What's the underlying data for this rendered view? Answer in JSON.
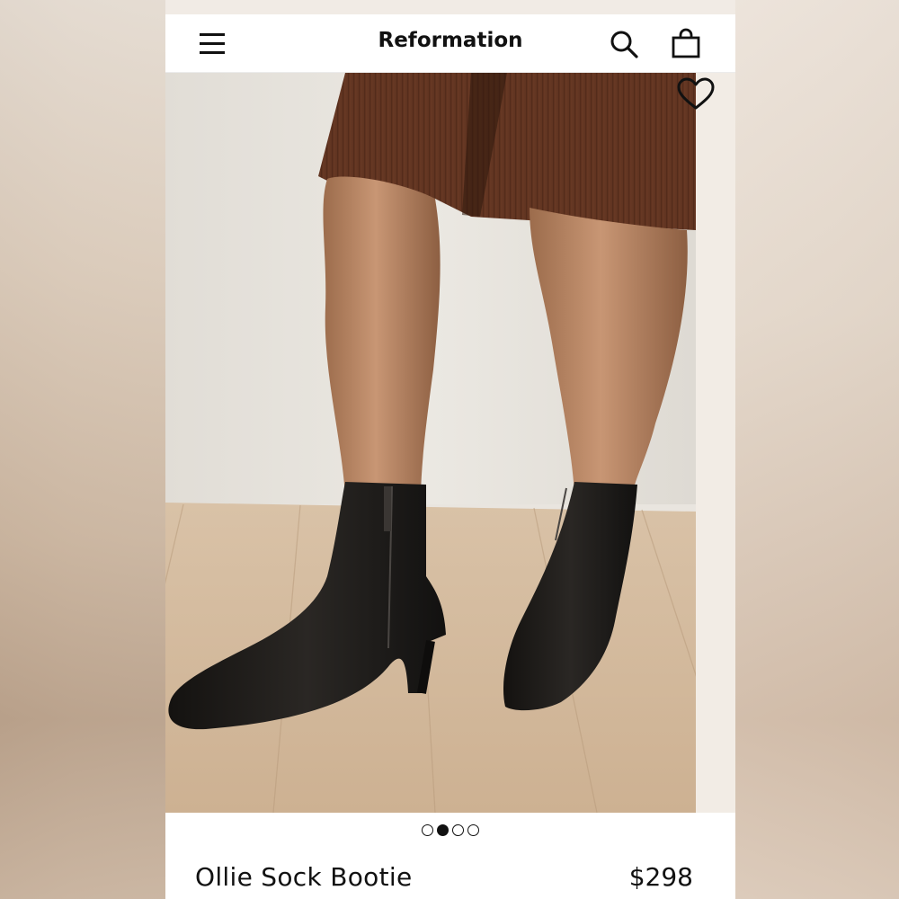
{
  "header": {
    "brand": "Reformation",
    "menu_icon": "hamburger-menu-icon",
    "search_icon": "search-icon",
    "bag_icon": "shopping-bag-icon"
  },
  "gallery": {
    "image_count": 4,
    "active_index": 1,
    "favorite_icon": "heart-outline-icon"
  },
  "product": {
    "name": "Ollie Sock Bootie",
    "price": "$298"
  },
  "colors": {
    "text": "#111111",
    "background": "#ffffff",
    "skirt": "#6a3a24",
    "boot": "#1b1917",
    "floor": "#d2b89c",
    "wall": "#e7e4de"
  }
}
